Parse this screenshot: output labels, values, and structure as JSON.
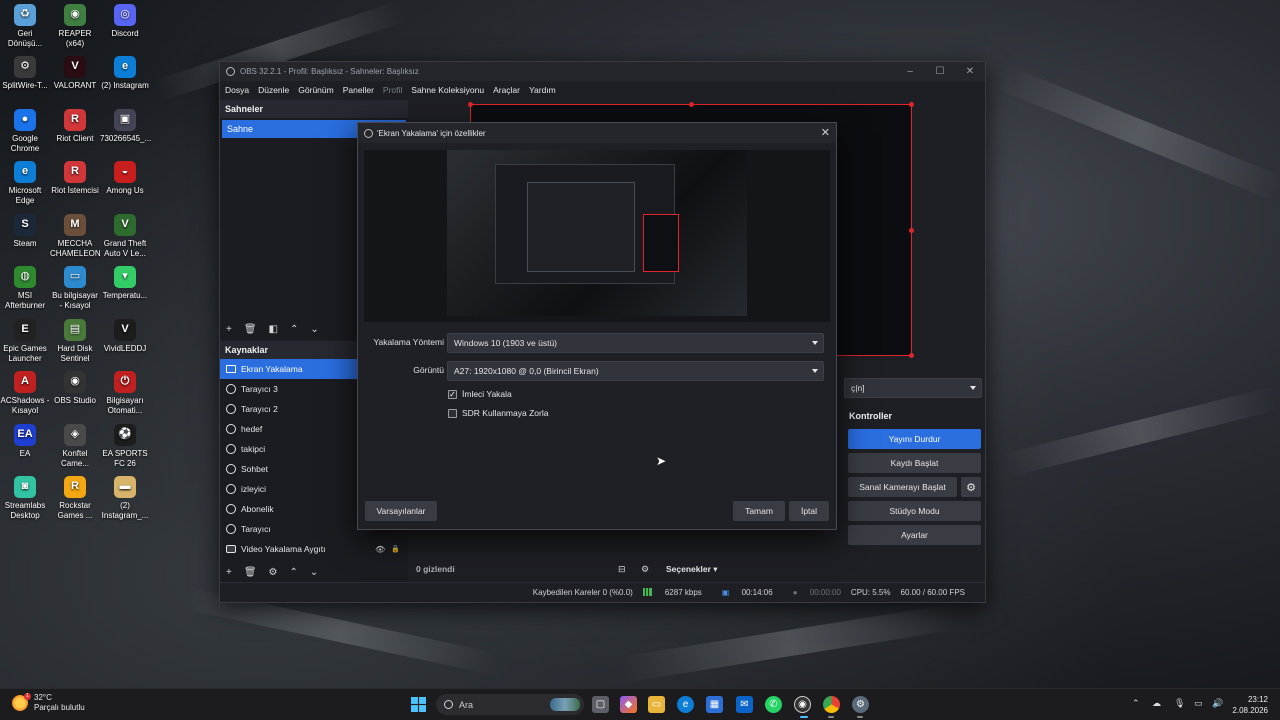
{
  "desktop": {
    "icons": [
      {
        "label": "Geri Dönüşü...",
        "glyph": "♻",
        "color": "#5aa0d8"
      },
      {
        "label": "REAPER (x64)",
        "glyph": "◉",
        "color": "#3f7f3f"
      },
      {
        "label": "Discord",
        "glyph": "◎",
        "color": "#5865f2"
      },
      {
        "label": "SplitWire-T...",
        "glyph": "⚙",
        "color": "#3a3a3a"
      },
      {
        "label": "VALORANT",
        "glyph": "V",
        "color": "#2a0d12"
      },
      {
        "label": "(2) Instagram",
        "glyph": "e",
        "color": "#0c7ed6"
      },
      {
        "label": "Google Chrome",
        "glyph": "●",
        "color": "#1a73e8"
      },
      {
        "label": "Riot Client",
        "glyph": "R",
        "color": "#d13639"
      },
      {
        "label": "730266545_...",
        "glyph": "▣",
        "color": "#445"
      },
      {
        "label": "Microsoft Edge",
        "glyph": "e",
        "color": "#0c7ed6"
      },
      {
        "label": "Riot İstemcisi",
        "glyph": "R",
        "color": "#d13639"
      },
      {
        "label": "Among Us",
        "glyph": "◒",
        "color": "#c81e1e"
      },
      {
        "label": "Steam",
        "glyph": "S",
        "color": "#1b2838"
      },
      {
        "label": "MECCHA CHAMELEON",
        "glyph": "M",
        "color": "#6b4f3a"
      },
      {
        "label": "Grand Theft Auto V Le...",
        "glyph": "V",
        "color": "#2e6b2e"
      },
      {
        "label": "MSI Afterburner",
        "glyph": "◍",
        "color": "#2f8a2f"
      },
      {
        "label": "Bu bilgisayar - Kısayol",
        "glyph": "▭",
        "color": "#2d8bd0"
      },
      {
        "label": "Temperatu...",
        "glyph": "▾",
        "color": "#3c6"
      },
      {
        "label": "Epic Games Launcher",
        "glyph": "E",
        "color": "#222"
      },
      {
        "label": "Hard Disk Sentinel",
        "glyph": "▤",
        "color": "#4a7a3a"
      },
      {
        "label": "VividLEDDJ",
        "glyph": "V",
        "color": "#1d1d1d"
      },
      {
        "label": "ACShadows - Kısayol",
        "glyph": "A",
        "color": "#c02020"
      },
      {
        "label": "OBS Studio",
        "glyph": "◉",
        "color": "#333"
      },
      {
        "label": "Bilgisayarı Otomati...",
        "glyph": "⏻",
        "color": "#c02020"
      },
      {
        "label": "EA",
        "glyph": "EA",
        "color": "#1f3fd0"
      },
      {
        "label": "Konftel Came...",
        "glyph": "◈",
        "color": "#4a4a4a"
      },
      {
        "label": "EA SPORTS FC 26",
        "glyph": "⚽",
        "color": "#1d1d1d"
      },
      {
        "label": "Streamlabs Desktop",
        "glyph": "◙",
        "color": "#31c3a2"
      },
      {
        "label": "Rockstar Games ...",
        "glyph": "R",
        "color": "#f3a712"
      },
      {
        "label": "(2) Instagram_...",
        "glyph": "▬",
        "color": "#d7b46a"
      }
    ]
  },
  "obs": {
    "title": "OBS 32.2.1 - Profil: Başlıksız - Sahneler: Başlıksız",
    "menu": [
      "Dosya",
      "Düzenle",
      "Görünüm",
      "Paneller",
      "Profil",
      "Sahne Koleksiyonu",
      "Araçlar",
      "Yardım"
    ],
    "scenes": {
      "title": "Sahneler",
      "items": [
        "Sahne"
      ]
    },
    "sources": {
      "title": "Kaynaklar",
      "items": [
        {
          "label": "Ekran Yakalama",
          "icon": "monitor-icon"
        },
        {
          "label": "Tarayıcı 3",
          "icon": "globe-icon"
        },
        {
          "label": "Tarayıcı 2",
          "icon": "globe-icon"
        },
        {
          "label": "hedef",
          "icon": "globe-icon"
        },
        {
          "label": "takipci",
          "icon": "globe-icon"
        },
        {
          "label": "Sohbet",
          "icon": "globe-icon"
        },
        {
          "label": "izleyici",
          "icon": "globe-icon"
        },
        {
          "label": "Abonelik",
          "icon": "globe-icon"
        },
        {
          "label": "Tarayıcı",
          "icon": "globe-icon"
        },
        {
          "label": "Video Yakalama Aygıtı",
          "icon": "camera-icon"
        }
      ]
    },
    "mixer": {
      "hidden_count": "0 gizlendi",
      "options": "Seçenekler"
    },
    "transition_partial": "ç|n]",
    "controls": {
      "title": "Kontroller",
      "stop_stream": "Yayını Durdur",
      "start_record": "Kaydı Başlat",
      "virtual_cam": "Sanal Kamerayı Başlat",
      "studio_mode": "Stüdyo Modu",
      "settings": "Ayarlar"
    },
    "status": {
      "dropped": "Kaybedilen Kareler 0 (%0.0)",
      "bitrate": "6287 kbps",
      "stream_time": "00:14:06",
      "record_time": "00:00:00",
      "cpu": "CPU: 5.5%",
      "fps": "60.00 / 60.00 FPS"
    }
  },
  "dialog": {
    "title": "'Ekran Yakalama' için özellikler",
    "capture_method_label": "Yakalama Yöntemi",
    "capture_method_value": "Windows 10 (1903 ve üstü)",
    "display_label": "Görüntü",
    "display_value": "A27: 1920x1080 @ 0,0 (Birincil Ekran)",
    "capture_cursor": "İmleci Yakala",
    "capture_cursor_checked": true,
    "force_sdr": "SDR Kullanmaya Zorla",
    "force_sdr_checked": false,
    "defaults_button": "Varsayılanlar",
    "ok_button": "Tamam",
    "cancel_button": "İptal"
  },
  "taskbar": {
    "weather_temp": "32°C",
    "weather_desc": "Parçalı bulutlu",
    "search_placeholder": "Ara",
    "time": "23:12",
    "date": "2.08.2026"
  },
  "colors": {
    "accent": "#2a6ee0",
    "recording_red": "#e0242b",
    "good_green": "#3fb950"
  }
}
